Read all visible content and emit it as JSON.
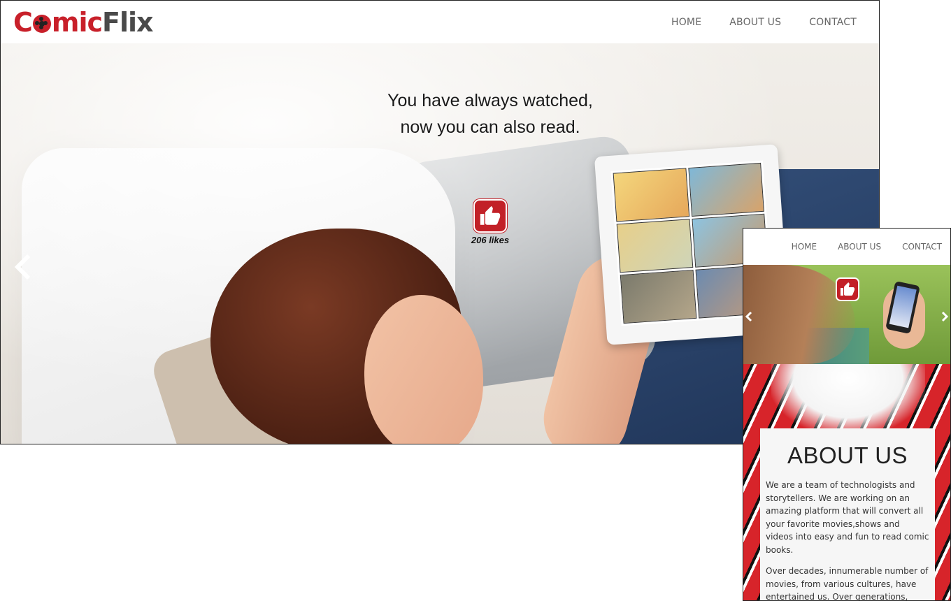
{
  "desktop": {
    "logo": {
      "part1": "Comic",
      "part2": "Flix"
    },
    "nav": [
      {
        "label": "HOME"
      },
      {
        "label": "ABOUT US"
      },
      {
        "label": "CONTACT"
      }
    ],
    "hero": {
      "tagline": "You have always watched, now you can also read.",
      "likes": "206 likes"
    }
  },
  "mobile": {
    "nav": [
      {
        "label": "HOME"
      },
      {
        "label": "ABOUT US"
      },
      {
        "label": "CONTACT"
      }
    ],
    "about": {
      "heading": "ABOUT US",
      "paragraphs": [
        "We are a team of technologists and storytellers. We are working on an amazing platform that will convert all your favorite movies,shows and videos into easy and fun to read comic books.",
        "Over decades, innumerable number of movies, from various cultures, have entertained us. Over generations, many television shows have touched our lives"
      ]
    }
  },
  "colors": {
    "brand_red": "#c8202a",
    "logo_gray": "#4a4a4a",
    "nav_text": "#666666"
  },
  "icons": [
    "reel-icon",
    "thumbs-up-icon",
    "chevron-left-icon",
    "chevron-right-icon"
  ]
}
